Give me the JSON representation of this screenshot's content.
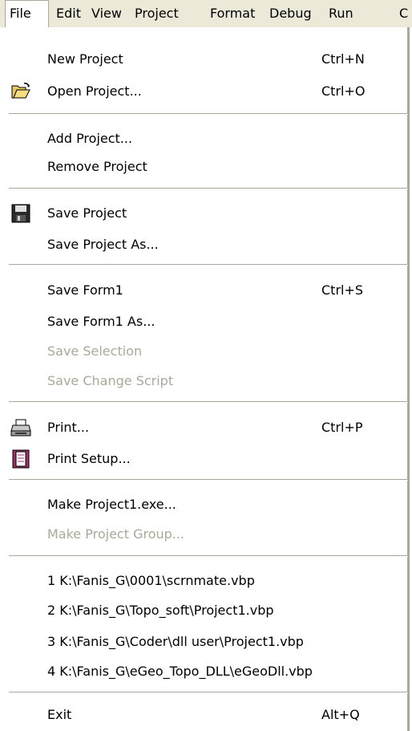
{
  "menubar": {
    "items": [
      {
        "label": "File",
        "active": true
      },
      {
        "label": "Edit"
      },
      {
        "label": "View"
      },
      {
        "label": "Project"
      },
      {
        "label": "Format"
      },
      {
        "label": "Debug"
      },
      {
        "label": "Run"
      },
      {
        "label": "C"
      }
    ]
  },
  "file_menu": {
    "items": [
      {
        "label": "New Project",
        "shortcut": "Ctrl+N"
      },
      {
        "label": "Open Project...",
        "shortcut": "Ctrl+O",
        "icon": "open-folder-icon"
      },
      {
        "label": "Add Project..."
      },
      {
        "label": "Remove Project"
      },
      {
        "label": "Save Project",
        "icon": "floppy-disk-icon"
      },
      {
        "label": "Save Project As..."
      },
      {
        "label": "Save Form1",
        "shortcut": "Ctrl+S"
      },
      {
        "label": "Save Form1 As..."
      },
      {
        "label": "Save Selection",
        "enabled": false
      },
      {
        "label": "Save Change Script",
        "enabled": false
      },
      {
        "label": "Print...",
        "shortcut": "Ctrl+P",
        "icon": "printer-icon"
      },
      {
        "label": "Print Setup...",
        "icon": "print-setup-icon"
      },
      {
        "label": "Make Project1.exe..."
      },
      {
        "label": "Make Project Group...",
        "enabled": false
      },
      {
        "label": "1 K:\\Fanis_G\\0001\\scrnmate.vbp"
      },
      {
        "label": "2 K:\\Fanis_G\\Topo_soft\\Project1.vbp"
      },
      {
        "label": "3 K:\\Fanis_G\\Coder\\dll user\\Project1.vbp"
      },
      {
        "label": "4 K:\\Fanis_G\\eGeo_Topo_DLL\\eGeoDll.vbp"
      },
      {
        "label": "Exit",
        "shortcut": "Alt+Q"
      }
    ]
  },
  "colors": {
    "menubar_bg": "#ece9d8",
    "menu_bg": "#ffffff",
    "disabled_text": "#aca899",
    "separator": "#aca899"
  }
}
